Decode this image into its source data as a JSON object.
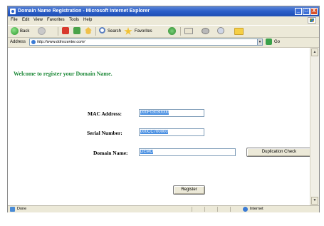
{
  "window": {
    "title": "Domain Name Registration - Microsoft Internet Explorer",
    "minimize": "_",
    "maximize": "□",
    "close": "X"
  },
  "menu": [
    "File",
    "Edit",
    "View",
    "Favorites",
    "Tools",
    "Help"
  ],
  "toolbar": {
    "back": "Back",
    "search": "Search",
    "favorites": "Favorites"
  },
  "address": {
    "label": "Address",
    "url": "http://www.ddnscenter.com/",
    "dropdown": "▾",
    "go": "Go"
  },
  "page": {
    "welcome": "Welcome to register your Domain Name.",
    "mac_label": "MAC Address:",
    "mac_value": "000F03030000",
    "serial_label": "Serial Number:",
    "serial_value": "000CC700000",
    "domain_label": "Domain Name:",
    "domain_value": "DEMO",
    "duplication_button": "Duplication Check",
    "register_button": "Register"
  },
  "status": {
    "text": "Done",
    "zone": "Internet"
  },
  "scrollbar": {
    "up": "▲",
    "down": "▼"
  }
}
